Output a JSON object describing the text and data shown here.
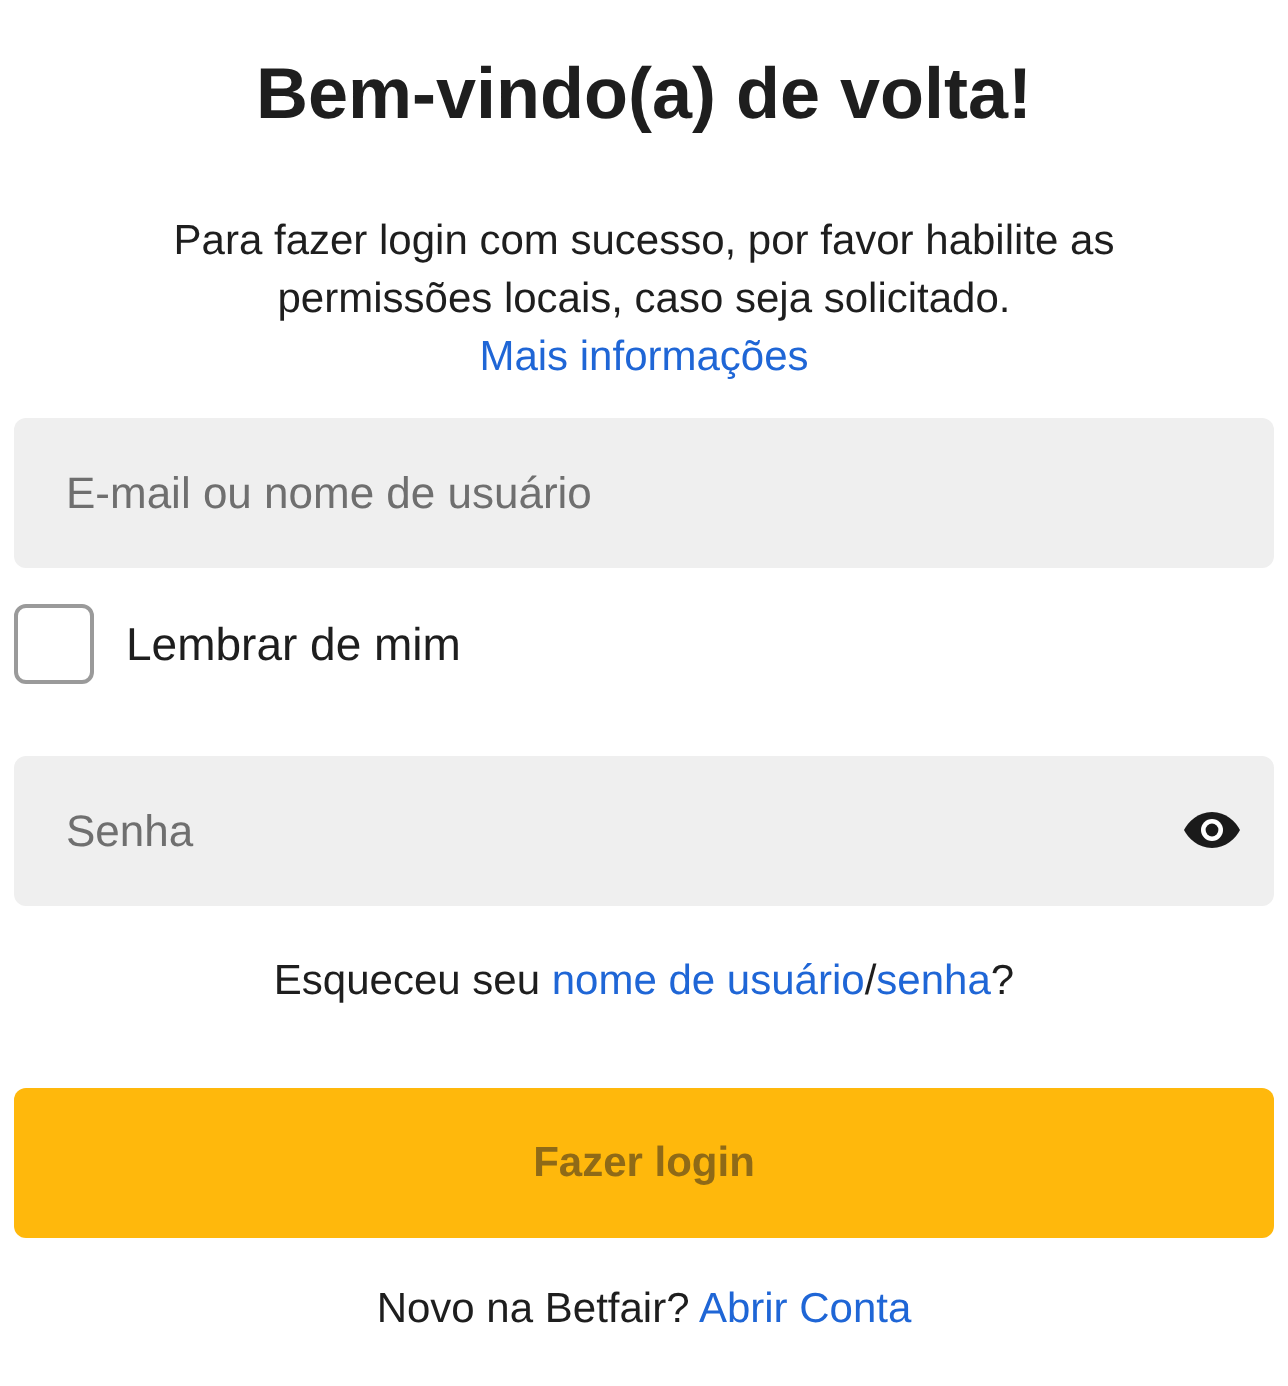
{
  "title": "Bem-vindo(a) de volta!",
  "intro": {
    "text": "Para fazer login com sucesso, por favor habilite as permissões locais, caso seja solicitado.",
    "link": "Mais informações"
  },
  "username": {
    "placeholder": "E-mail ou nome de usuário"
  },
  "remember": {
    "label": "Lembrar de mim",
    "checked": false
  },
  "password": {
    "placeholder": "Senha"
  },
  "forgot": {
    "prefix": "Esqueceu seu",
    "username_link": "nome de usuário",
    "separator": "/",
    "password_link": "senha",
    "suffix": "?"
  },
  "login_button": {
    "label": "Fazer login",
    "disabled": true
  },
  "signup": {
    "prefix": "Novo na Betfair?",
    "link": "Abrir Conta"
  }
}
